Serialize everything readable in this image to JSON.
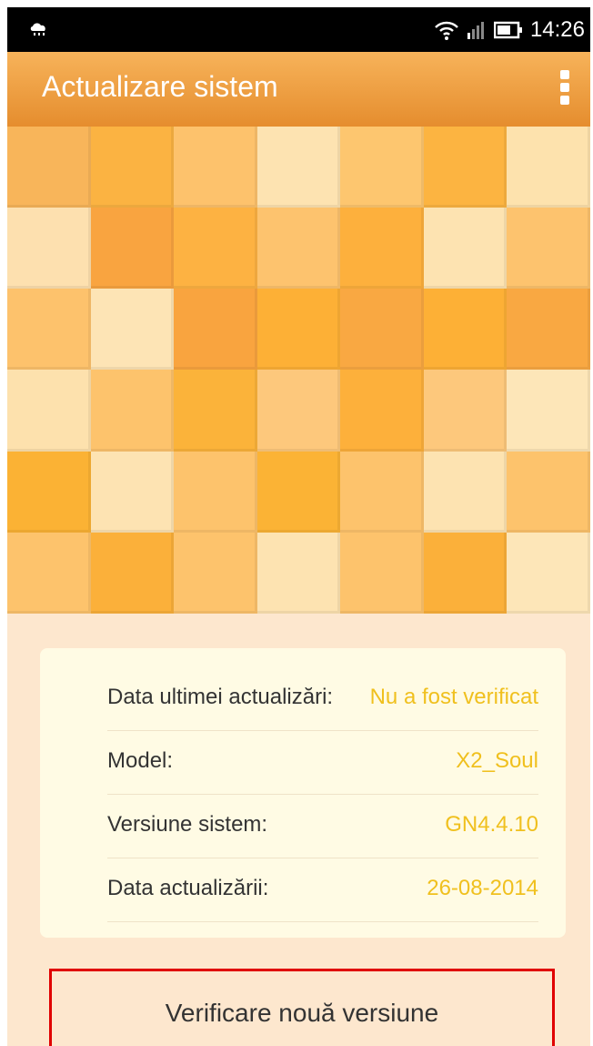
{
  "status_bar": {
    "time": "14:26",
    "left_icon": "weather-cloud-icon",
    "icons": [
      "wifi-icon",
      "signal-icon",
      "battery-icon"
    ]
  },
  "app_bar": {
    "title": "Actualizare sistem",
    "menu_icon": "overflow-menu-icon"
  },
  "mosaic": {
    "colors": [
      "#f8b55a",
      "#fbb342",
      "#fdc26c",
      "#fde3b1",
      "#fdc66f",
      "#fcb441",
      "#fde2ad",
      "#fde0af",
      "#f9a440",
      "#fdb242",
      "#fdc36e",
      "#fdb03d",
      "#fde3b1",
      "#fdc36e",
      "#fdc26c",
      "#fde4b5",
      "#f9a43f",
      "#fdb036",
      "#f9a842",
      "#fdb036",
      "#f9a842",
      "#fde1ad",
      "#fdc36c",
      "#fbb33a",
      "#fdc87c",
      "#fdb03b",
      "#fdc87c",
      "#fde6b8",
      "#fbb234",
      "#fde3b2",
      "#fdc36c",
      "#fbb335",
      "#fdc36c",
      "#fde3b1",
      "#fdc36c",
      "#fdc36c",
      "#fbb03a",
      "#fdc36c",
      "#fde3b1",
      "#fdc36c",
      "#fbb03a",
      "#fde6b8"
    ]
  },
  "info": {
    "rows": [
      {
        "label": "Data ultimei actualizări:",
        "value": "Nu a fost verificat"
      },
      {
        "label": "Model:",
        "value": "X2_Soul"
      },
      {
        "label": "Versiune sistem:",
        "value": "GN4.4.10"
      },
      {
        "label": "Data actualizării:",
        "value": "26-08-2014"
      }
    ]
  },
  "actions": {
    "check_new_version": "Verificare nouă versiune"
  },
  "colors": {
    "accent": "#f0c01e",
    "app_bar": "#ee9b3e",
    "highlight": "#e00000"
  }
}
